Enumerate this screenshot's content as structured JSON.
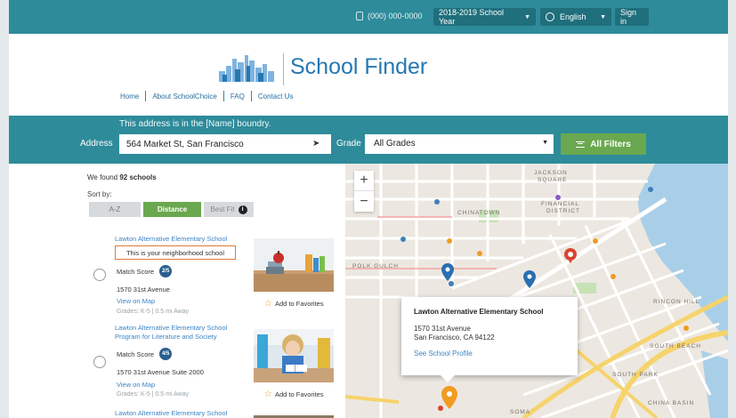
{
  "topbar": {
    "phone": "(000) 000-0000",
    "school_year": "2018-2019 School Year",
    "language": "English",
    "sign_in": "Sign in"
  },
  "header": {
    "logo_text": "School Finder",
    "nav": [
      "Home",
      "About SchoolChoice",
      "FAQ",
      "Contact Us"
    ]
  },
  "search": {
    "boundary_note": "This address is in the [Name] boundry.",
    "address_label": "Address",
    "address_value": "564 Market St, San Francisco",
    "grade_label": "Grade",
    "grade_value": "All Grades",
    "filters_label": "All Filters"
  },
  "results": {
    "found_prefix": "We found ",
    "found_count": "92 schools",
    "sort_label": "Sort by:",
    "sort_options": [
      "A-Z",
      "Distance",
      "Best Fit"
    ],
    "selected_sort": "Distance",
    "schools": [
      {
        "name": "Lawton Alternative Elementary School",
        "badge": "This is your neighborhood school",
        "match_label": "Match Score",
        "match_score": "2/5",
        "address": "1570 31st Avenue",
        "view_map": "View on Map",
        "meta": "Grades: K-5  |  0.5 mi Away",
        "favorite": "Add to Favorites"
      },
      {
        "name": "Lawton Alternative Elementary School Program for Literature and Society",
        "match_label": "Match Score",
        "match_score": "4/5",
        "address": "1570 31st Avenue Suite 2000",
        "view_map": "View on Map",
        "meta": "Grades: K-5  |  0.5 mi Away",
        "favorite": "Add to Favorites"
      },
      {
        "name": "Lawton Alternative Elementary School"
      }
    ]
  },
  "map": {
    "zoom_in": "+",
    "zoom_out": "−",
    "labels": {
      "jackson_square": "JACKSON\nSQUARE",
      "financial_district": "FINANCIAL\nDISTRICT",
      "chinatown": "CHINATOWN",
      "polk_gulch": "POLK GULCH",
      "rincon_hill": "RINCON HILL",
      "south_beach": "SOUTH BEACH",
      "south_park": "SOUTH PARK",
      "china_basin": "CHINA BASIN",
      "soma": "SOMA"
    },
    "popup": {
      "title": "Lawton Alternative Elementary School",
      "line1": "1570 31st Avenue",
      "line2": "San Francisco, CA 94122",
      "link": "See School Profile"
    },
    "colors": {
      "water": "#a9cfe8",
      "land": "#ece8e1",
      "road": "#ffffff",
      "highway": "#f6d36c",
      "pin_blue": "#2a6fb3",
      "pin_orange": "#f29b21",
      "pin_red": "#d9432f"
    }
  },
  "colors": {
    "teal": "#2e8b9a",
    "green": "#6aa84f",
    "link": "#3d85c6",
    "brand_blue": "#2678b0"
  }
}
